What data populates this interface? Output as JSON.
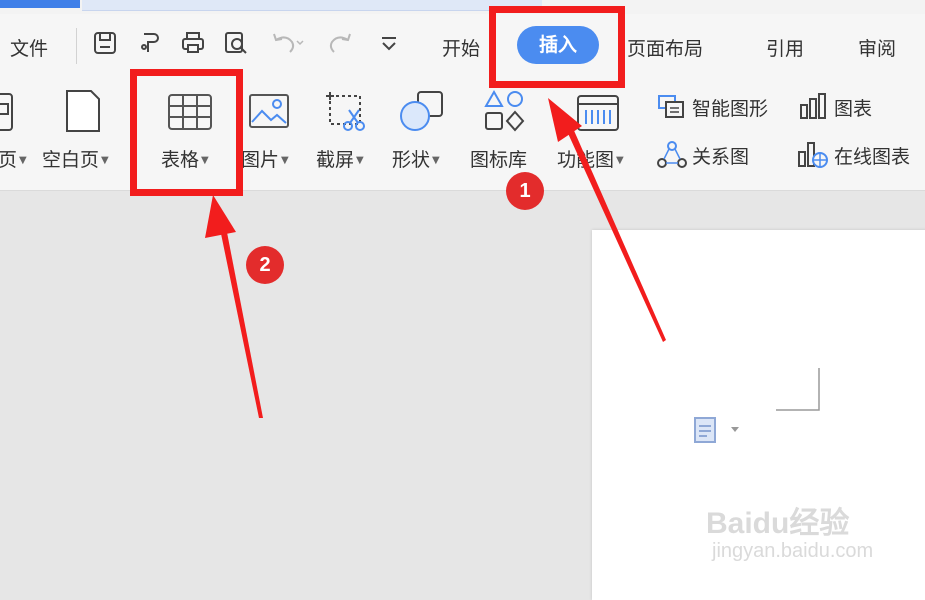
{
  "menu": {
    "file_label": "文件",
    "tabs": [
      {
        "label": "开始"
      },
      {
        "label": "插入",
        "active": true
      },
      {
        "label": "页面布局"
      },
      {
        "label": "引用"
      },
      {
        "label": "审阅"
      }
    ]
  },
  "ribbon": {
    "items": [
      {
        "label": "页"
      },
      {
        "label": "空白页"
      },
      {
        "label": "表格"
      },
      {
        "label": "图片"
      },
      {
        "label": "截屏"
      },
      {
        "label": "形状"
      },
      {
        "label": "图标库"
      },
      {
        "label": "功能图"
      }
    ],
    "side_items": [
      {
        "label": "智能图形"
      },
      {
        "label": "图表"
      },
      {
        "label": "关系图"
      },
      {
        "label": "在线图表"
      }
    ]
  },
  "annotations": {
    "badge1": "1",
    "badge2": "2",
    "highlight_color": "#f21d1d",
    "accent_color": "#4b8cf0"
  },
  "watermark": {
    "brand": "Baidu经验",
    "url": "jingyan.baidu.com"
  }
}
